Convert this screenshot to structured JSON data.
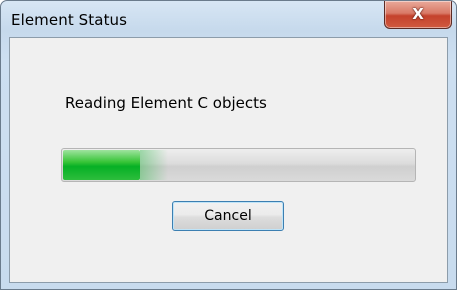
{
  "window": {
    "title": "Element Status",
    "close_icon": "close-icon",
    "close_glyph": "X"
  },
  "status": {
    "message": "Reading Element C objects",
    "progress_fraction": 0.22,
    "progress_color": "#06b025"
  },
  "actions": {
    "cancel_label": "Cancel"
  }
}
